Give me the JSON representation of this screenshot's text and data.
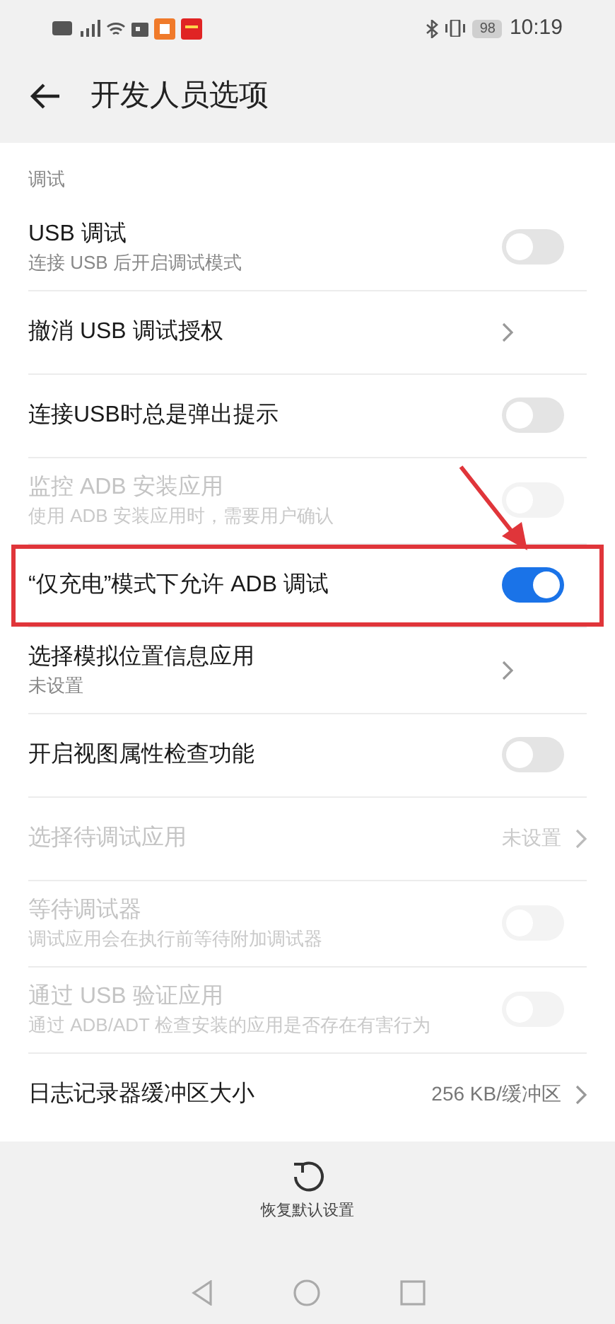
{
  "status_bar": {
    "battery": "98",
    "time": "10:19"
  },
  "header": {
    "title": "开发人员选项"
  },
  "section": {
    "label": "调试"
  },
  "rows": [
    {
      "kind": "toggle",
      "title": "USB 调试",
      "subtitle": "连接 USB 后开启调试模式",
      "on": false,
      "disabled": false,
      "highlighted": false
    },
    {
      "kind": "link",
      "title": "撤消 USB 调试授权",
      "disabled": false,
      "highlighted": false
    },
    {
      "kind": "toggle",
      "title": "连接USB时总是弹出提示",
      "on": false,
      "disabled": false,
      "highlighted": false
    },
    {
      "kind": "toggle",
      "title": "监控 ADB 安装应用",
      "subtitle": "使用 ADB 安装应用时，需要用户确认",
      "on": false,
      "disabled": true,
      "highlighted": false
    },
    {
      "kind": "toggle",
      "title": "“仅充电”模式下允许 ADB 调试",
      "on": true,
      "disabled": false,
      "highlighted": true
    },
    {
      "kind": "link",
      "title": "选择模拟位置信息应用",
      "subtitle": "未设置",
      "disabled": false,
      "highlighted": false
    },
    {
      "kind": "toggle",
      "title": "开启视图属性检查功能",
      "on": false,
      "disabled": false,
      "highlighted": false
    },
    {
      "kind": "link",
      "title": "选择待调试应用",
      "value": "未设置",
      "disabled": true,
      "highlighted": false
    },
    {
      "kind": "toggle",
      "title": "等待调试器",
      "subtitle": "调试应用会在执行前等待附加调试器",
      "on": false,
      "disabled": true,
      "highlighted": false
    },
    {
      "kind": "toggle",
      "title": "通过 USB 验证应用",
      "subtitle": "通过 ADB/ADT 检查安装的应用是否存在有害行为",
      "on": false,
      "disabled": true,
      "highlighted": false
    },
    {
      "kind": "link",
      "title": "日志记录器缓冲区大小",
      "value": "256 KB/缓冲区",
      "disabled": false,
      "highlighted": false
    }
  ],
  "footer": {
    "restore_label": "恢复默认设置"
  }
}
